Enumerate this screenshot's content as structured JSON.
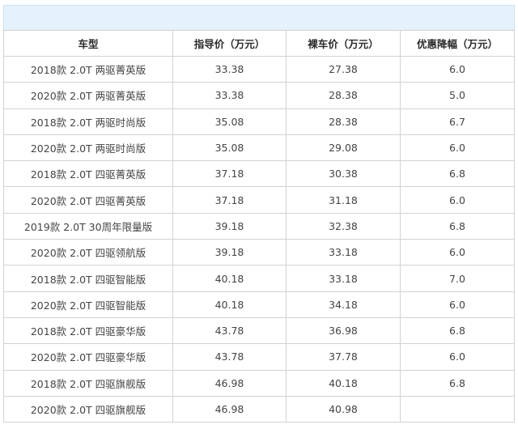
{
  "table": {
    "headers": [
      "车型",
      "指导价（万元）",
      "裸车价（万元）",
      "优惠降幅（万元）"
    ],
    "rows": [
      [
        "2018款 2.0T 两驱菁英版",
        "33.38",
        "27.38",
        "6.0"
      ],
      [
        "2020款 2.0T 两驱菁英版",
        "33.38",
        "28.38",
        "5.0"
      ],
      [
        "2018款 2.0T 两驱时尚版",
        "35.08",
        "28.38",
        "6.7"
      ],
      [
        "2020款 2.0T 两驱时尚版",
        "35.08",
        "29.08",
        "6.0"
      ],
      [
        "2018款 2.0T 四驱菁英版",
        "37.18",
        "30.38",
        "6.8"
      ],
      [
        "2020款 2.0T 四驱菁英版",
        "37.18",
        "31.18",
        "6.0"
      ],
      [
        "2019款 2.0T 30周年限量版",
        "39.18",
        "32.38",
        "6.8"
      ],
      [
        "2020款 2.0T 四驱领航版",
        "39.18",
        "33.18",
        "6.0"
      ],
      [
        "2018款 2.0T 四驱智能版",
        "40.18",
        "33.18",
        "7.0"
      ],
      [
        "2020款 2.0T 四驱智能版",
        "40.18",
        "34.18",
        "6.0"
      ],
      [
        "2018款 2.0T 四驱豪华版",
        "43.78",
        "36.98",
        "6.8"
      ],
      [
        "2020款 2.0T 四驱豪华版",
        "43.78",
        "37.78",
        "6.0"
      ],
      [
        "2018款 2.0T 四驱旗舰版",
        "46.98",
        "40.18",
        "6.8"
      ],
      [
        "2020款 2.0T 四驱旗舰版",
        "46.98",
        "40.98",
        ""
      ]
    ]
  },
  "colors": {
    "header_band": "#e6f2fb",
    "border": "#d2d2d2",
    "text": "#444444"
  }
}
